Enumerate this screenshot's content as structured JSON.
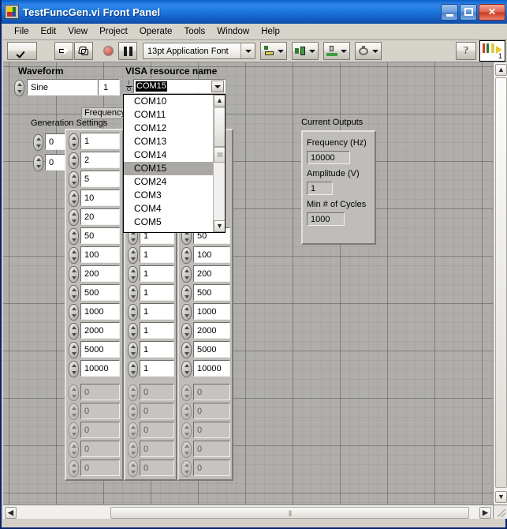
{
  "window": {
    "title": "TestFuncGen.vi Front Panel",
    "icon": "labview-vi-icon",
    "buttons": {
      "minimize": "minimize-button",
      "maximize": "maximize-button",
      "close": "close-button"
    }
  },
  "menubar": {
    "items": [
      "File",
      "Edit",
      "View",
      "Project",
      "Operate",
      "Tools",
      "Window",
      "Help"
    ]
  },
  "toolbar": {
    "run_label": "run-arrow",
    "run_continuous_label": "run-continuously",
    "abort_label": "abort-execution",
    "pause_label": "pause",
    "font_selector": "13pt Application Font",
    "align_objects": "Align Objects",
    "distribute_objects": "Distribute Objects",
    "resize_objects": "Resize Objects",
    "reorder": "Reorder",
    "help": "?",
    "vi_icon_number": "1"
  },
  "panel": {
    "waveform": {
      "label": "Waveform",
      "value": "Sine",
      "index": "1"
    },
    "visa": {
      "label": "VISA resource name",
      "value": "COM15",
      "options": [
        "COM10",
        "COM11",
        "COM12",
        "COM13",
        "COM14",
        "COM15",
        "COM24",
        "COM3",
        "COM4",
        "COM5"
      ],
      "selected": "COM15"
    },
    "generation_settings": {
      "label": "Generation Settings",
      "values": [
        "0",
        "0"
      ]
    },
    "frequency_column": {
      "label": "Frequency (Hz",
      "values": [
        "1",
        "2",
        "5",
        "10",
        "20",
        "50",
        "100",
        "200",
        "500",
        "1000",
        "2000",
        "5000",
        "10000",
        "0",
        "0",
        "0",
        "0",
        "0"
      ]
    },
    "amplitude_column": {
      "values": [
        "1",
        "1",
        "1",
        "1",
        "1",
        "1",
        "1",
        "1",
        "0",
        "0",
        "0",
        "0",
        "0"
      ]
    },
    "cycles_column": {
      "values": [
        "50",
        "100",
        "200",
        "500",
        "1000",
        "2000",
        "5000",
        "10000",
        "0",
        "0",
        "0",
        "0",
        "0"
      ]
    },
    "current_outputs": {
      "label": "Current Outputs",
      "fields": [
        {
          "label": "Frequency (Hz)",
          "value": "10000"
        },
        {
          "label": "Amplitude (V)",
          "value": "1"
        },
        {
          "label": "Min # of Cycles",
          "value": "1000"
        }
      ]
    }
  },
  "colors": {
    "titlebar": "#1f7ade",
    "panel_bg": "#b0aeab",
    "control_bg": "#bfbdb9",
    "entry_bg": "#ffffff",
    "entry_dim": "#c6c4c0",
    "selection": "#aaa8a4",
    "close_button": "#cc3a22"
  }
}
